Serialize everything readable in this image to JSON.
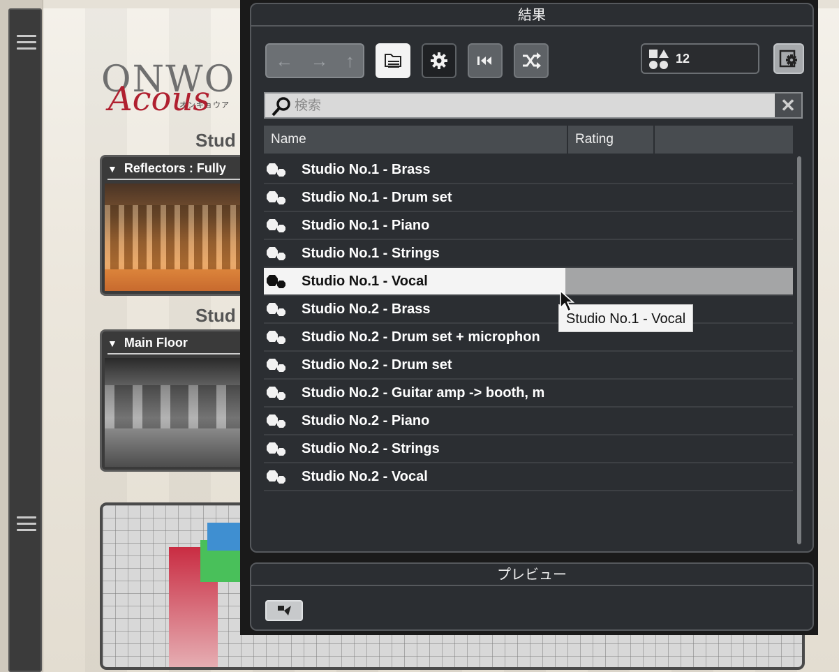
{
  "background": {
    "logo_word": "ONWO",
    "logo_script": "Acous",
    "logo_kana": "オンキョウア",
    "studio_heading_1": "Stud",
    "studio_heading_2": "Stud",
    "card1_title": "Reflectors : Fully",
    "card2_title": "Main Floor"
  },
  "results": {
    "title": "結果",
    "count": "12",
    "search_placeholder": "検索",
    "columns": [
      "Name",
      "Rating",
      ""
    ],
    "rows": [
      {
        "name": "Studio No.1 - Brass",
        "selected": false
      },
      {
        "name": "Studio No.1 - Drum set",
        "selected": false
      },
      {
        "name": "Studio No.1 - Piano",
        "selected": false
      },
      {
        "name": "Studio No.1 - Strings",
        "selected": false
      },
      {
        "name": "Studio No.1 - Vocal",
        "selected": true
      },
      {
        "name": "Studio No.2 - Brass",
        "selected": false
      },
      {
        "name": "Studio No.2 - Drum set + microphon",
        "selected": false
      },
      {
        "name": "Studio No.2 - Drum set",
        "selected": false
      },
      {
        "name": "Studio No.2 - Guitar amp -> booth, m",
        "selected": false
      },
      {
        "name": "Studio No.2 - Piano",
        "selected": false
      },
      {
        "name": "Studio No.2 - Strings",
        "selected": false
      },
      {
        "name": "Studio No.2 - Vocal",
        "selected": false
      }
    ],
    "tooltip": "Studio No.1 - Vocal"
  },
  "preview": {
    "title": "プレビュー"
  },
  "icons": {
    "nav_back": "arrow-left-icon",
    "nav_forward": "arrow-right-icon",
    "nav_up": "arrow-up-icon",
    "filter": "folder-list-icon",
    "settings": "gear-icon",
    "rewind": "rewind-icon",
    "shuffle": "shuffle-icon",
    "shapes": "shapes-icon",
    "config": "window-gear-icon",
    "search": "search-icon",
    "clear": "close-icon",
    "preset": "preset-icon"
  },
  "colors": {
    "panel_bg": "#2b2e32",
    "selected_row": "#f4f4f4",
    "accent_red": "#b02030"
  }
}
